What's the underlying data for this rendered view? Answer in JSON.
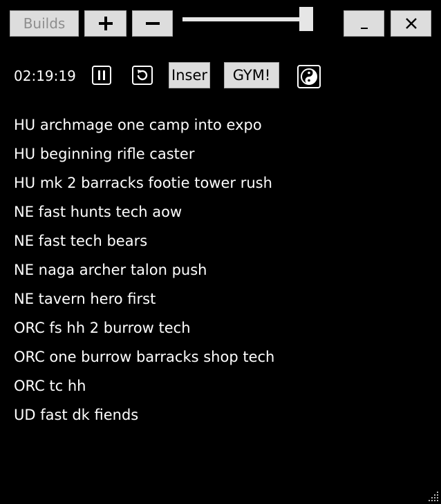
{
  "toolbar": {
    "builds_label": "Builds",
    "zoom_in_icon": "plus-icon",
    "zoom_out_icon": "minus-icon",
    "opacity_slider_value": 0.95,
    "minimize_label": "_",
    "close_label": "✕"
  },
  "controls": {
    "timer": "02:19:19",
    "pause_icon": "pause-icon",
    "restart_icon": "restart-icon",
    "insert_label": "Inser",
    "gym_label": "GYM!",
    "yinyang_icon": "yin-yang-icon"
  },
  "builds": [
    "HU archmage one camp into expo",
    "HU beginning rifle caster",
    "HU mk 2 barracks footie tower rush",
    "NE fast hunts tech aow",
    "NE fast tech bears",
    "NE naga archer talon push",
    "NE tavern hero first",
    "ORC fs hh 2 burrow tech",
    "ORC one burrow barracks shop tech",
    "ORC tc hh",
    "UD fast dk fiends"
  ],
  "colors": {
    "background": "#000000",
    "button_face": "#dddddd",
    "text": "#ffffff",
    "disabled_text": "#8d8d8d"
  }
}
